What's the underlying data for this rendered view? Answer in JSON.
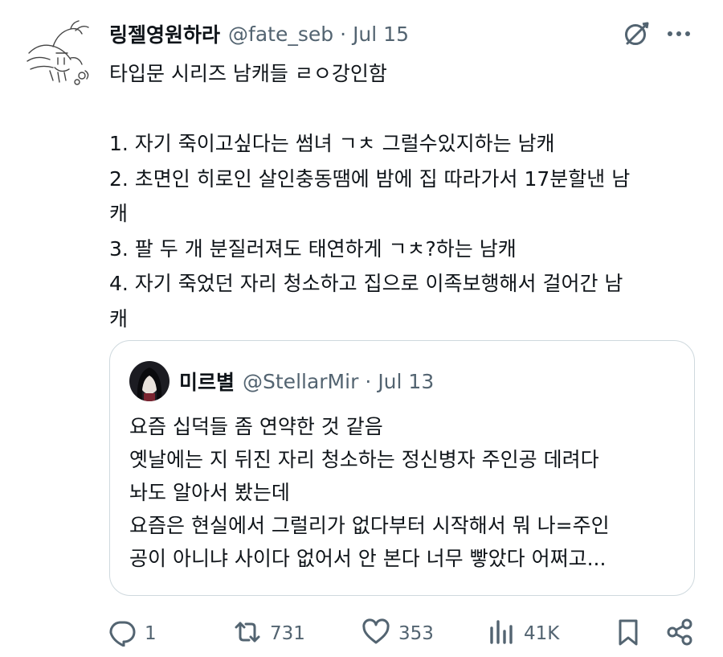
{
  "post": {
    "display_name": "링젤영원하라",
    "handle": "@fate_seb",
    "separator": "·",
    "date": "Jul 15",
    "lines": [
      "타입문 시리즈 남캐들 ㄹㅇ강인함",
      "",
      "1. 자기 죽이고싶다는 썸녀 ㄱㅊ 그럴수있지하는 남캐",
      "2. 초면인 히로인 살인충동땜에 밤에 집 따라가서 17분할낸 남",
      "캐",
      "3. 팔 두 개 분질러져도 태연하게 ㄱㅊ?하는 남캐",
      "4. 자기 죽었던 자리 청소하고 집으로 이족보행해서 걸어간 남",
      "캐"
    ]
  },
  "quote": {
    "display_name": "미르별",
    "handle": "@StellarMir",
    "separator": "·",
    "date": "Jul 13",
    "lines": [
      "요즘 십덕들 좀 연약한 것 같음",
      "옛날에는 지 뒤진 자리 청소하는 정신병자 주인공 데려다",
      "놔도 알아서 봤는데",
      "요즘은 현실에서 그럴리가 없다부터 시작해서 뭐 나=주인",
      "공이 아니냐 사이다 없어서 안 본다 너무 빻았다 어쩌고..."
    ]
  },
  "actions": {
    "reply_count": "1",
    "repost_count": "731",
    "like_count": "353",
    "view_count": "41K"
  },
  "icons": {
    "grok": "grok-icon",
    "more": "more-icon",
    "reply": "reply-icon",
    "repost": "repost-icon",
    "like": "like-icon",
    "views": "views-icon",
    "bookmark": "bookmark-icon",
    "share": "share-icon"
  },
  "colors": {
    "text": "#0f1419",
    "secondary": "#536471",
    "border": "#cfd9de"
  }
}
